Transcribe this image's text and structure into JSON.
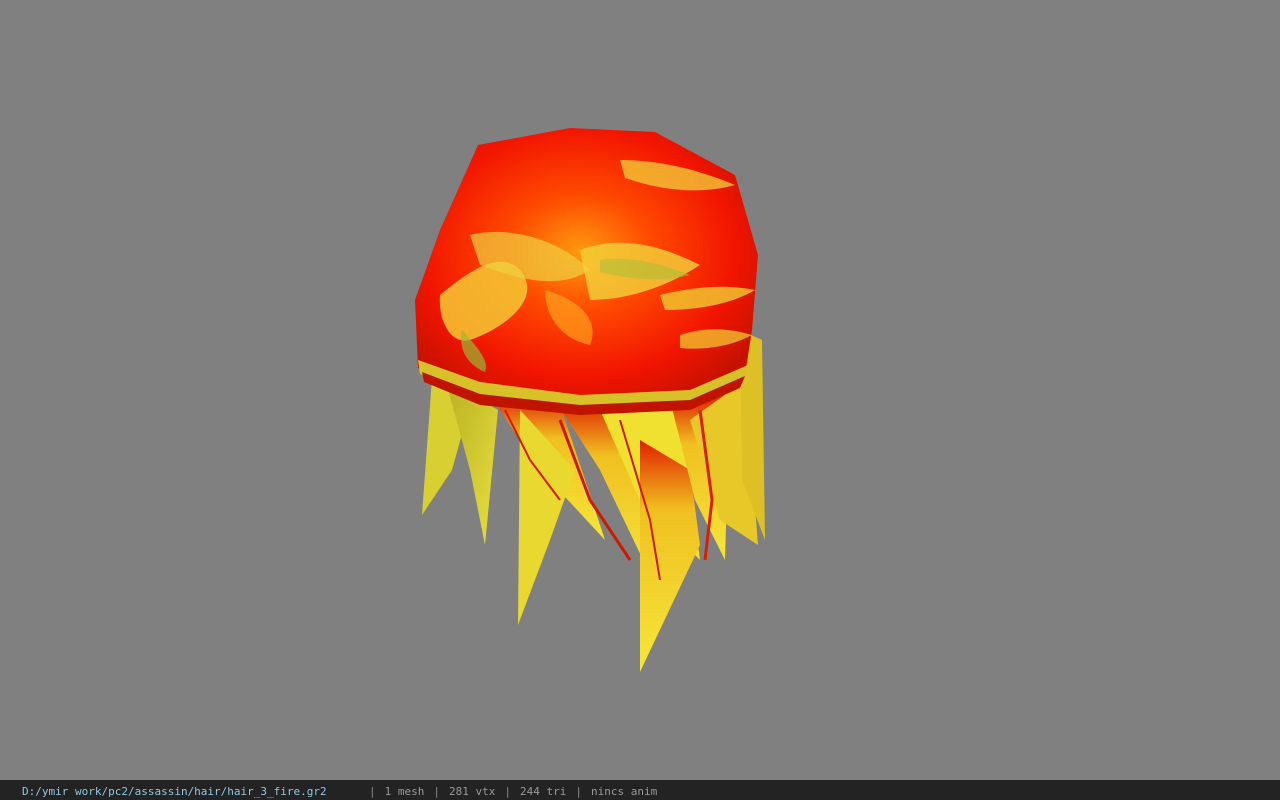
{
  "viewer": {
    "background_color": "#808080",
    "model_name": "hair_3_fire"
  },
  "status": {
    "file_path": "D:/ymir work/pc2/assassin/hair/hair_3_fire.gr2",
    "mesh_count": "1 mesh",
    "vertex_count": "281 vtx",
    "triangle_count": "244 tri",
    "animation": "nincs anim",
    "separator": "|"
  },
  "colors": {
    "hair_red": "#ff1a00",
    "hair_orange": "#ff7a00",
    "hair_yellow": "#f5e23a",
    "path_text": "#8fc8e0",
    "statusbar_bg": "#232323"
  }
}
